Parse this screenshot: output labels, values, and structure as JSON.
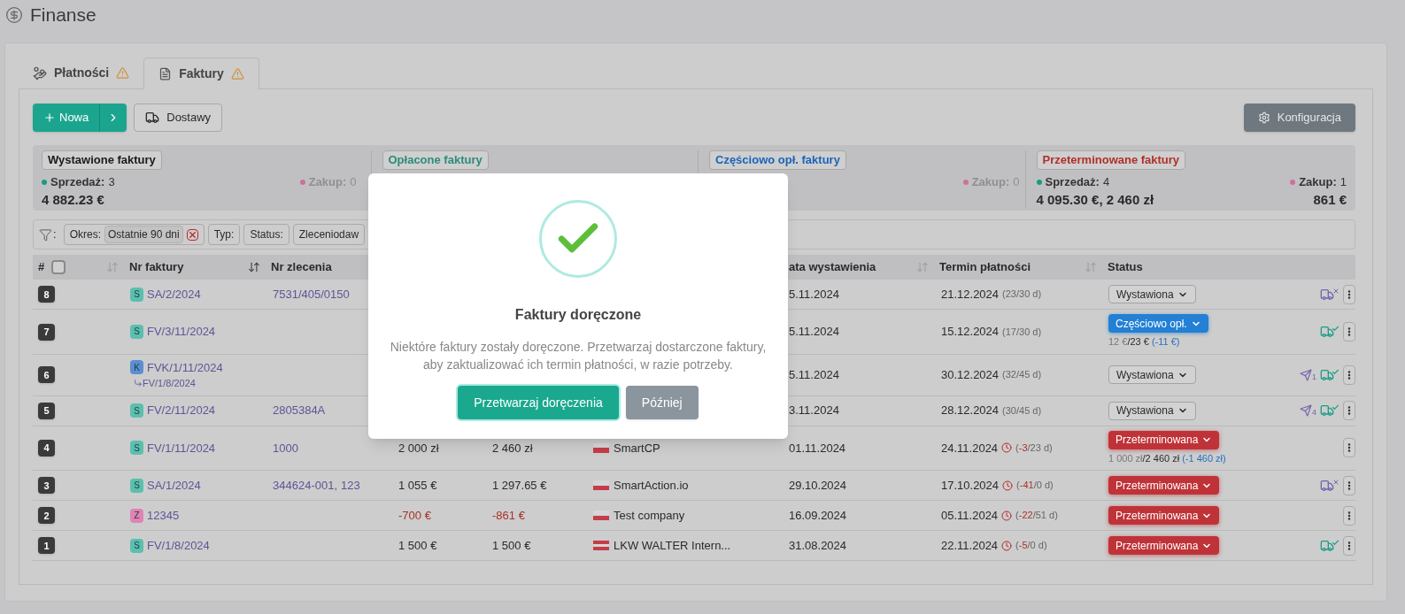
{
  "page": {
    "title": "Finanse"
  },
  "tabs": [
    {
      "label": "Płatności",
      "warning": true,
      "selected": false
    },
    {
      "label": "Faktury",
      "warning": true,
      "selected": true
    }
  ],
  "toolbar": {
    "new_button": "Nowa",
    "deliveries_button": "Dostawy",
    "config_button": "Konfiguracja"
  },
  "summary_cards": [
    {
      "title": "Wystawione faktury",
      "color": "#1a1a1a",
      "sale": {
        "label": "Sprzedaż:",
        "count": "3",
        "amount": "4 882.23 €",
        "dim": false
      },
      "purchase": {
        "label": "Zakup:",
        "count": "0",
        "dim": true
      }
    },
    {
      "title": "Opłacone faktury",
      "color": "#2e8b7a"
    },
    {
      "title": "Częściowo opł. faktury",
      "color": "#1b64b8",
      "purchase": {
        "label": "Zakup:",
        "count": "0",
        "dim": true
      }
    },
    {
      "title": "Przeterminowane faktury",
      "color": "#b0302a",
      "sale": {
        "label": "Sprzedaż:",
        "count": "4",
        "amount": "4 095.30 €, 2 460 zł",
        "dim": false
      },
      "purchase": {
        "label": "Zakup:",
        "count": "1",
        "amount": "861 €",
        "dim": false
      }
    }
  ],
  "filter_bar": {
    "label": ":"
  },
  "filters": [
    {
      "label": "Okres:",
      "value": "Ostatnie 90 dni",
      "removable": true
    },
    {
      "label": "Typ:"
    },
    {
      "label": "Status:"
    },
    {
      "label": "Zleceniodaw"
    }
  ],
  "table": {
    "select_all": {
      "checked": false
    },
    "columns": [
      {
        "label": "#",
        "sortable": true,
        "sort_active": false
      },
      {
        "label": "Nr faktury",
        "sortable": true,
        "sort_active": true
      },
      {
        "label": "Nr zlecenia",
        "sortable": false
      },
      {
        "label": "ata wystawienia",
        "sortable": true,
        "sort_active": false
      },
      {
        "label": "Termin płatności",
        "sortable": true,
        "sort_active": false
      },
      {
        "label": "Status",
        "sortable": false
      }
    ],
    "rows": [
      {
        "number": "8",
        "doc_type": {
          "letter": "S",
          "color": "#5bbfae"
        },
        "invoice": "SA/2/2024",
        "orders": [
          {
            "label": "7531/405/0150"
          }
        ],
        "issue_date": "5.11.2024",
        "due": {
          "date": "21.12.2024",
          "open": "(",
          "days": "23",
          "rest": "/30 d)",
          "overdue": false
        },
        "status": {
          "label": "Wystawiona",
          "kind": "issued"
        },
        "actions": [
          {
            "kind": "truck-x"
          }
        ]
      },
      {
        "number": "7",
        "doc_type": {
          "letter": "S",
          "color": "#5bbfae"
        },
        "invoice": "FV/3/11/2024",
        "issue_date": "5.11.2024",
        "due": {
          "date": "15.12.2024",
          "open": "(",
          "days": "17",
          "rest": "/30 d)",
          "overdue": false
        },
        "status": {
          "label": "Częściowo opł.",
          "kind": "partial"
        },
        "payment": {
          "paid": "12 €",
          "total": "/23 €",
          "diff": "(-11 €)"
        },
        "actions": [
          {
            "kind": "truck-check"
          }
        ]
      },
      {
        "number": "6",
        "doc_type": {
          "letter": "K",
          "color": "#5a8fd0"
        },
        "invoice": "FVK/1/11/2024",
        "related": "FV/1/8/2024",
        "issue_date": "5.11.2024",
        "due": {
          "date": "30.12.2024",
          "open": "(",
          "days": "32",
          "rest": "/45 d)",
          "overdue": false
        },
        "status": {
          "label": "Wystawiona",
          "kind": "issued"
        },
        "actions": [
          {
            "kind": "send",
            "count": "1"
          },
          {
            "kind": "truck-check"
          }
        ]
      },
      {
        "number": "5",
        "doc_type": {
          "letter": "S",
          "color": "#5bbfae"
        },
        "invoice": "FV/2/11/2024",
        "orders": [
          {
            "label": "2805384A"
          }
        ],
        "issue_date": "3.11.2024",
        "due": {
          "date": "28.12.2024",
          "open": "(",
          "days": "30",
          "rest": "/45 d)",
          "overdue": false
        },
        "status": {
          "label": "Wystawiona",
          "kind": "issued"
        },
        "actions": [
          {
            "kind": "send",
            "count": "4"
          },
          {
            "kind": "truck-check"
          }
        ]
      },
      {
        "number": "4",
        "doc_type": {
          "letter": "S",
          "color": "#5bbfae"
        },
        "invoice": "FV/1/11/2024",
        "orders": [
          {
            "label": "1000"
          }
        ],
        "net": {
          "text": "2 000 zł",
          "negative": false
        },
        "gross": {
          "text": "2 460 zł",
          "negative": false
        },
        "company": {
          "name": "SmartCP",
          "kind": "pl"
        },
        "issue_date": "01.11.2024",
        "due": {
          "date": "24.11.2024",
          "open": "(",
          "days": "-3",
          "rest": "/23 d)",
          "overdue": true
        },
        "status": {
          "label": "Przeterminowana",
          "kind": "overdue"
        },
        "payment": {
          "paid": "1 000 zł",
          "total": "/2 460 zł",
          "diff": "(-1 460 zł)"
        }
      },
      {
        "number": "3",
        "doc_type": {
          "letter": "S",
          "color": "#5bbfae"
        },
        "invoice": "SA/1/2024",
        "orders": [
          {
            "label": "344624-001",
            "sep": ","
          },
          {
            "label": "123"
          }
        ],
        "net": {
          "text": "1 055 €",
          "negative": false
        },
        "gross": {
          "text": "1 297.65 €",
          "negative": false
        },
        "company": {
          "name": "SmartAction.io",
          "kind": "pl"
        },
        "issue_date": "29.10.2024",
        "due": {
          "date": "17.10.2024",
          "open": "(",
          "days": "-41",
          "rest": "/0 d)",
          "overdue": true
        },
        "status": {
          "label": "Przeterminowana",
          "kind": "overdue"
        },
        "actions": [
          {
            "kind": "truck-x"
          }
        ]
      },
      {
        "number": "2",
        "doc_type": {
          "letter": "Z",
          "color": "#e083b4"
        },
        "invoice": "12345",
        "net": {
          "text": "-700 €",
          "negative": true
        },
        "gross": {
          "text": "-861 €",
          "negative": true
        },
        "company": {
          "name": "Test company",
          "kind": "pl"
        },
        "issue_date": "16.09.2024",
        "due": {
          "date": "05.11.2024",
          "open": "(",
          "days": "-22",
          "rest": "/51 d)",
          "overdue": true
        },
        "status": {
          "label": "Przeterminowana",
          "kind": "overdue"
        }
      },
      {
        "number": "1",
        "doc_type": {
          "letter": "S",
          "color": "#5bbfae"
        },
        "invoice": "FV/1/8/2024",
        "net": {
          "text": "1 500 €",
          "negative": false
        },
        "gross": {
          "text": "1 500 €",
          "negative": false
        },
        "company": {
          "name": "LKW WALTER Intern...",
          "kind": "at"
        },
        "issue_date": "31.08.2024",
        "due": {
          "date": "22.11.2024",
          "open": "(",
          "days": "-5",
          "rest": "/0 d)",
          "overdue": true
        },
        "status": {
          "label": "Przeterminowana",
          "kind": "overdue"
        },
        "actions": [
          {
            "kind": "truck-check"
          }
        ]
      }
    ]
  },
  "modal": {
    "title": "Faktury doręczone",
    "message": "Niektóre faktury zostały doręczone. Przetwarzaj dostarczone faktury, aby zaktualizować ich termin płatności, w razie potrzeby.",
    "primary_button": "Przetwarzaj doręczenia",
    "secondary_button": "Później"
  }
}
